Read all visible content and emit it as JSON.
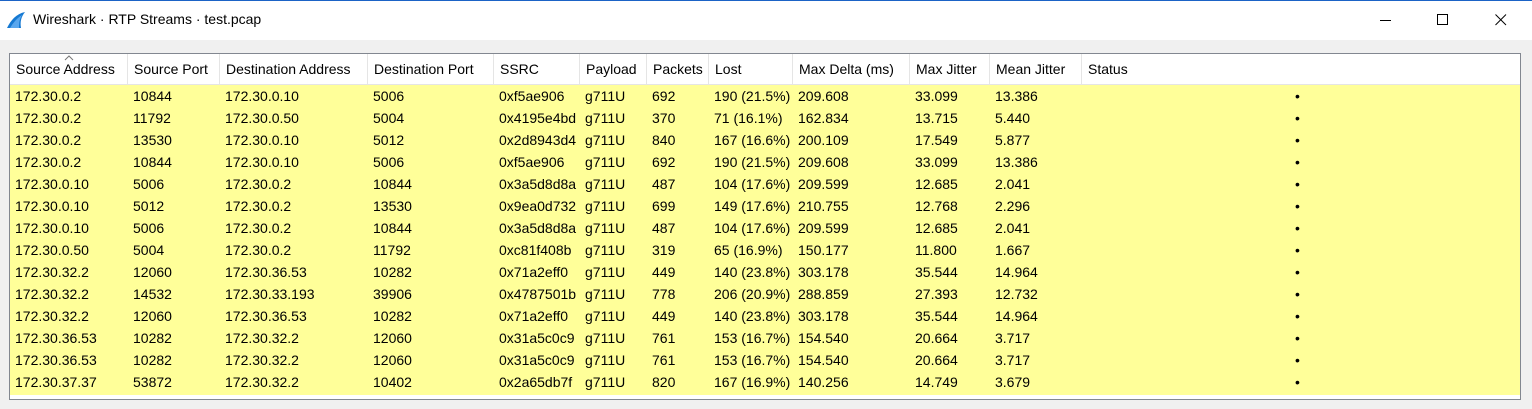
{
  "window": {
    "title": "Wireshark · RTP Streams · test.pcap"
  },
  "table": {
    "columns": [
      "Source Address",
      "Source Port",
      "Destination Address",
      "Destination Port",
      "SSRC",
      "Payload",
      "Packets",
      "Lost",
      "Max Delta (ms)",
      "Max Jitter",
      "Mean Jitter",
      "Status"
    ],
    "rows": [
      [
        "172.30.0.2",
        "10844",
        "172.30.0.10",
        "5006",
        "0xf5ae906",
        "g711U",
        "692",
        "190 (21.5%)",
        "209.608",
        "33.099",
        "13.386",
        "•"
      ],
      [
        "172.30.0.2",
        "11792",
        "172.30.0.50",
        "5004",
        "0x4195e4bd",
        "g711U",
        "370",
        "71 (16.1%)",
        "162.834",
        "13.715",
        "5.440",
        "•"
      ],
      [
        "172.30.0.2",
        "13530",
        "172.30.0.10",
        "5012",
        "0x2d8943d4",
        "g711U",
        "840",
        "167 (16.6%)",
        "200.109",
        "17.549",
        "5.877",
        "•"
      ],
      [
        "172.30.0.2",
        "10844",
        "172.30.0.10",
        "5006",
        "0xf5ae906",
        "g711U",
        "692",
        "190 (21.5%)",
        "209.608",
        "33.099",
        "13.386",
        "•"
      ],
      [
        "172.30.0.10",
        "5006",
        "172.30.0.2",
        "10844",
        "0x3a5d8d8a",
        "g711U",
        "487",
        "104 (17.6%)",
        "209.599",
        "12.685",
        "2.041",
        "•"
      ],
      [
        "172.30.0.10",
        "5012",
        "172.30.0.2",
        "13530",
        "0x9ea0d732",
        "g711U",
        "699",
        "149 (17.6%)",
        "210.755",
        "12.768",
        "2.296",
        "•"
      ],
      [
        "172.30.0.10",
        "5006",
        "172.30.0.2",
        "10844",
        "0x3a5d8d8a",
        "g711U",
        "487",
        "104 (17.6%)",
        "209.599",
        "12.685",
        "2.041",
        "•"
      ],
      [
        "172.30.0.50",
        "5004",
        "172.30.0.2",
        "11792",
        "0xc81f408b",
        "g711U",
        "319",
        "65 (16.9%)",
        "150.177",
        "11.800",
        "1.667",
        "•"
      ],
      [
        "172.30.32.2",
        "12060",
        "172.30.36.53",
        "10282",
        "0x71a2eff0",
        "g711U",
        "449",
        "140 (23.8%)",
        "303.178",
        "35.544",
        "14.964",
        "•"
      ],
      [
        "172.30.32.2",
        "14532",
        "172.30.33.193",
        "39906",
        "0x4787501b",
        "g711U",
        "778",
        "206 (20.9%)",
        "288.859",
        "27.393",
        "12.732",
        "•"
      ],
      [
        "172.30.32.2",
        "12060",
        "172.30.36.53",
        "10282",
        "0x71a2eff0",
        "g711U",
        "449",
        "140 (23.8%)",
        "303.178",
        "35.544",
        "14.964",
        "•"
      ],
      [
        "172.30.36.53",
        "10282",
        "172.30.32.2",
        "12060",
        "0x31a5c0c9",
        "g711U",
        "761",
        "153 (16.7%)",
        "154.540",
        "20.664",
        "3.717",
        "•"
      ],
      [
        "172.30.36.53",
        "10282",
        "172.30.32.2",
        "12060",
        "0x31a5c0c9",
        "g711U",
        "761",
        "153 (16.7%)",
        "154.540",
        "20.664",
        "3.717",
        "•"
      ],
      [
        "172.30.37.37",
        "53872",
        "172.30.32.2",
        "10402",
        "0x2a65db7f",
        "g711U",
        "820",
        "167 (16.9%)",
        "140.256",
        "14.749",
        "3.679",
        "•"
      ]
    ]
  },
  "colors": {
    "row_highlight": "#ffff99",
    "title_accent": "#1b63c6"
  },
  "icons": {
    "app": "wireshark-fin-icon",
    "minimize": "minimize-icon",
    "maximize": "maximize-icon",
    "close": "close-icon",
    "sort": "sort-ascending-icon"
  }
}
